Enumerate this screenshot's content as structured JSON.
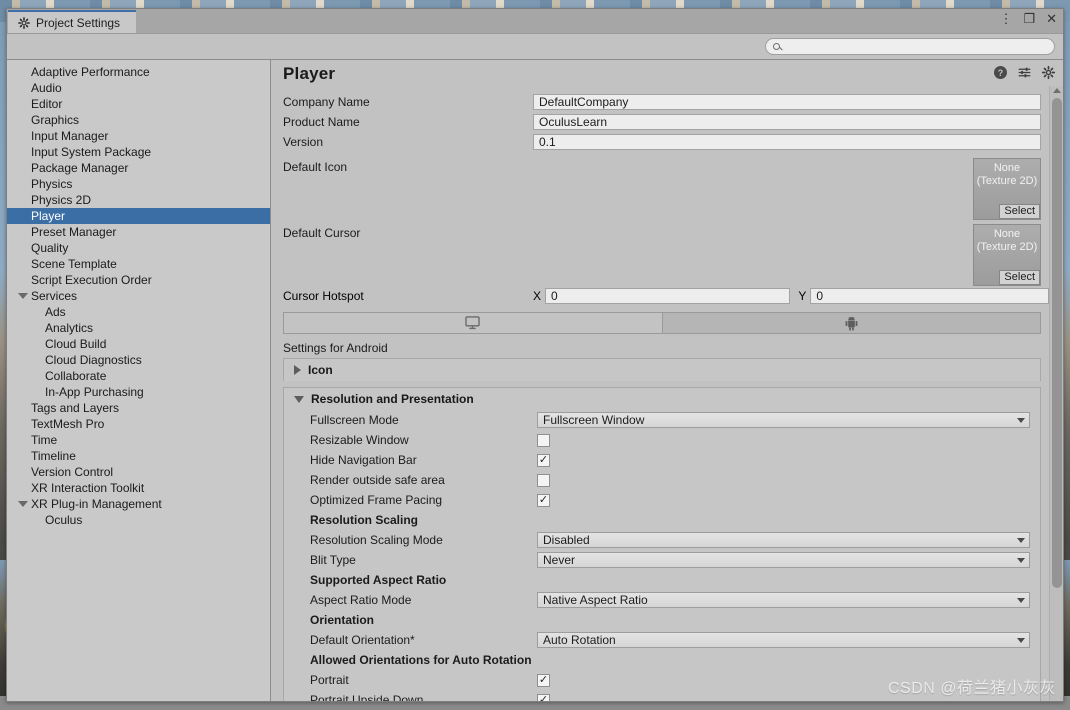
{
  "window": {
    "tab_title": "Project Settings",
    "tab_icon": "gear-icon",
    "controls": {
      "menu": "⋮",
      "maximize": "❐",
      "close": "✕"
    }
  },
  "search": {
    "value": "",
    "placeholder": "",
    "icon": "search-icon"
  },
  "sidebar": {
    "items": [
      {
        "label": "Adaptive Performance",
        "level": 0,
        "selected": false,
        "expandable": false
      },
      {
        "label": "Audio",
        "level": 0,
        "selected": false,
        "expandable": false
      },
      {
        "label": "Editor",
        "level": 0,
        "selected": false,
        "expandable": false
      },
      {
        "label": "Graphics",
        "level": 0,
        "selected": false,
        "expandable": false
      },
      {
        "label": "Input Manager",
        "level": 0,
        "selected": false,
        "expandable": false
      },
      {
        "label": "Input System Package",
        "level": 0,
        "selected": false,
        "expandable": false
      },
      {
        "label": "Package Manager",
        "level": 0,
        "selected": false,
        "expandable": false
      },
      {
        "label": "Physics",
        "level": 0,
        "selected": false,
        "expandable": false
      },
      {
        "label": "Physics 2D",
        "level": 0,
        "selected": false,
        "expandable": false
      },
      {
        "label": "Player",
        "level": 0,
        "selected": true,
        "expandable": false
      },
      {
        "label": "Preset Manager",
        "level": 0,
        "selected": false,
        "expandable": false
      },
      {
        "label": "Quality",
        "level": 0,
        "selected": false,
        "expandable": false
      },
      {
        "label": "Scene Template",
        "level": 0,
        "selected": false,
        "expandable": false
      },
      {
        "label": "Script Execution Order",
        "level": 0,
        "selected": false,
        "expandable": false
      },
      {
        "label": "Services",
        "level": 0,
        "selected": false,
        "expandable": true
      },
      {
        "label": "Ads",
        "level": 1,
        "selected": false,
        "expandable": false
      },
      {
        "label": "Analytics",
        "level": 1,
        "selected": false,
        "expandable": false
      },
      {
        "label": "Cloud Build",
        "level": 1,
        "selected": false,
        "expandable": false
      },
      {
        "label": "Cloud Diagnostics",
        "level": 1,
        "selected": false,
        "expandable": false
      },
      {
        "label": "Collaborate",
        "level": 1,
        "selected": false,
        "expandable": false
      },
      {
        "label": "In-App Purchasing",
        "level": 1,
        "selected": false,
        "expandable": false
      },
      {
        "label": "Tags and Layers",
        "level": 0,
        "selected": false,
        "expandable": false
      },
      {
        "label": "TextMesh Pro",
        "level": 0,
        "selected": false,
        "expandable": false
      },
      {
        "label": "Time",
        "level": 0,
        "selected": false,
        "expandable": false
      },
      {
        "label": "Timeline",
        "level": 0,
        "selected": false,
        "expandable": false
      },
      {
        "label": "Version Control",
        "level": 0,
        "selected": false,
        "expandable": false
      },
      {
        "label": "XR Interaction Toolkit",
        "level": 0,
        "selected": false,
        "expandable": false
      },
      {
        "label": "XR Plug-in Management",
        "level": 0,
        "selected": false,
        "expandable": true
      },
      {
        "label": "Oculus",
        "level": 1,
        "selected": false,
        "expandable": false
      }
    ]
  },
  "panel": {
    "title": "Player",
    "header_icons": [
      {
        "name": "help-icon",
        "glyph": "?"
      },
      {
        "name": "preset-icon",
        "glyph": "preset"
      },
      {
        "name": "gear-icon",
        "glyph": "gear"
      }
    ],
    "fields": [
      {
        "label": "Company Name",
        "value": "DefaultCompany"
      },
      {
        "label": "Product Name",
        "value": "OculusLearn"
      },
      {
        "label": "Version",
        "value": "0.1"
      }
    ],
    "object_fields": [
      {
        "label": "Default Icon",
        "value_line1": "None",
        "value_line2": "(Texture 2D)",
        "button": "Select"
      },
      {
        "label": "Default Cursor",
        "value_line1": "None",
        "value_line2": "(Texture 2D)",
        "button": "Select"
      }
    ],
    "cursor_hotspot": {
      "label": "Cursor Hotspot",
      "x_axis": "X",
      "x_value": "0",
      "y_axis": "Y",
      "y_value": "0"
    },
    "platform_tabs": [
      {
        "name": "standalone-tab",
        "icon": "monitor-icon",
        "active": true
      },
      {
        "name": "android-tab",
        "icon": "android-icon",
        "active": false
      }
    ],
    "settings_for_label": "Settings for Android",
    "sections": [
      {
        "title": "Icon",
        "open": false,
        "rows": []
      },
      {
        "title": "Resolution and Presentation",
        "open": true,
        "rows": [
          {
            "type": "dropdown",
            "label": "Fullscreen Mode",
            "value": "Fullscreen Window"
          },
          {
            "type": "checkbox",
            "label": "Resizable Window",
            "checked": false
          },
          {
            "type": "checkbox",
            "label": "Hide Navigation Bar",
            "checked": true
          },
          {
            "type": "checkbox",
            "label": "Render outside safe area",
            "checked": false
          },
          {
            "type": "checkbox",
            "label": "Optimized Frame Pacing",
            "checked": true
          },
          {
            "type": "group",
            "label": "Resolution Scaling"
          },
          {
            "type": "dropdown",
            "label": "Resolution Scaling Mode",
            "value": "Disabled"
          },
          {
            "type": "dropdown",
            "label": "Blit Type",
            "value": "Never"
          },
          {
            "type": "group",
            "label": "Supported Aspect Ratio"
          },
          {
            "type": "dropdown",
            "label": "Aspect Ratio Mode",
            "value": "Native Aspect Ratio"
          },
          {
            "type": "group",
            "label": "Orientation"
          },
          {
            "type": "dropdown",
            "label": "Default Orientation*",
            "value": "Auto Rotation"
          },
          {
            "type": "group",
            "label": "Allowed Orientations for Auto Rotation"
          },
          {
            "type": "checkbox",
            "label": "Portrait",
            "checked": true
          },
          {
            "type": "checkbox",
            "label": "Portrait Upside Down",
            "checked": true
          }
        ]
      }
    ]
  },
  "watermark": {
    "text": "CSDN @荷兰猪小灰灰"
  },
  "colors": {
    "selection_blue": "#3b6ea5",
    "window_bg": "#c2c2c2",
    "sidebar_bg": "#c9c9c9",
    "field_bg": "#ededed"
  }
}
